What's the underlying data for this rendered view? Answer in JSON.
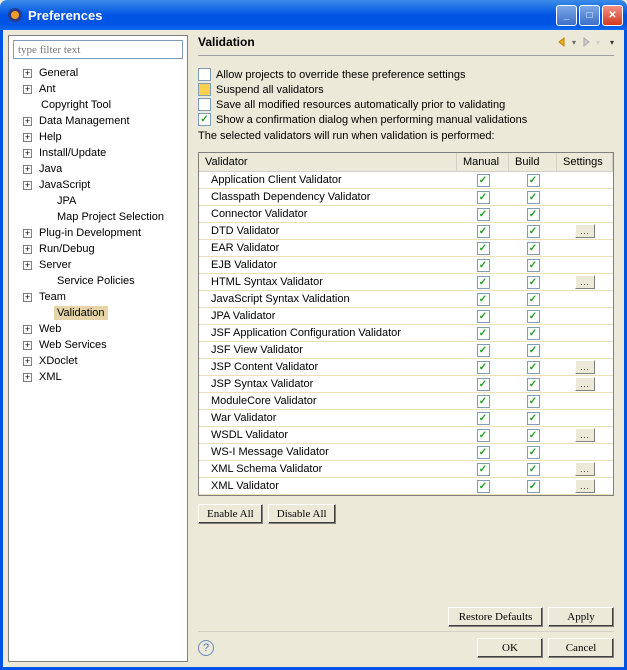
{
  "window": {
    "title": "Preferences"
  },
  "filter": {
    "placeholder": "type filter text"
  },
  "tree": [
    {
      "label": "General",
      "expand": "+",
      "indent": 1
    },
    {
      "label": "Ant",
      "expand": "+",
      "indent": 1
    },
    {
      "label": "Copyright Tool",
      "expand": "",
      "indent": 1
    },
    {
      "label": "Data Management",
      "expand": "+",
      "indent": 1
    },
    {
      "label": "Help",
      "expand": "+",
      "indent": 1
    },
    {
      "label": "Install/Update",
      "expand": "+",
      "indent": 1
    },
    {
      "label": "Java",
      "expand": "+",
      "indent": 1
    },
    {
      "label": "JavaScript",
      "expand": "+",
      "indent": 1
    },
    {
      "label": "JPA",
      "expand": "",
      "indent": 2
    },
    {
      "label": "Map Project Selection",
      "expand": "",
      "indent": 2
    },
    {
      "label": "Plug-in Development",
      "expand": "+",
      "indent": 1
    },
    {
      "label": "Run/Debug",
      "expand": "+",
      "indent": 1
    },
    {
      "label": "Server",
      "expand": "+",
      "indent": 1
    },
    {
      "label": "Service Policies",
      "expand": "",
      "indent": 2
    },
    {
      "label": "Team",
      "expand": "+",
      "indent": 1
    },
    {
      "label": "Validation",
      "expand": "",
      "indent": 2,
      "selected": true
    },
    {
      "label": "Web",
      "expand": "+",
      "indent": 1
    },
    {
      "label": "Web Services",
      "expand": "+",
      "indent": 1
    },
    {
      "label": "XDoclet",
      "expand": "+",
      "indent": 1
    },
    {
      "label": "XML",
      "expand": "+",
      "indent": 1
    }
  ],
  "header": {
    "title": "Validation"
  },
  "options": {
    "override": "Allow projects to override these preference settings",
    "suspend": "Suspend all validators",
    "saveAll": "Save all modified resources automatically prior to validating",
    "confirm": "Show a confirmation dialog when performing manual validations",
    "info": "The selected validators will run when validation is performed:"
  },
  "tableHeaders": {
    "validator": "Validator",
    "manual": "Manual",
    "build": "Build",
    "settings": "Settings"
  },
  "validators": [
    {
      "name": "Application Client Validator",
      "manual": true,
      "build": true,
      "settings": false
    },
    {
      "name": "Classpath Dependency Validator",
      "manual": true,
      "build": true,
      "settings": false
    },
    {
      "name": "Connector Validator",
      "manual": true,
      "build": true,
      "settings": false
    },
    {
      "name": "DTD Validator",
      "manual": true,
      "build": true,
      "settings": true
    },
    {
      "name": "EAR Validator",
      "manual": true,
      "build": true,
      "settings": false
    },
    {
      "name": "EJB Validator",
      "manual": true,
      "build": true,
      "settings": false
    },
    {
      "name": "HTML Syntax Validator",
      "manual": true,
      "build": true,
      "settings": true
    },
    {
      "name": "JavaScript Syntax Validation",
      "manual": true,
      "build": true,
      "settings": false
    },
    {
      "name": "JPA Validator",
      "manual": true,
      "build": true,
      "settings": false
    },
    {
      "name": "JSF Application Configuration Validator",
      "manual": true,
      "build": true,
      "settings": false
    },
    {
      "name": "JSF View Validator",
      "manual": true,
      "build": true,
      "settings": false
    },
    {
      "name": "JSP Content Validator",
      "manual": true,
      "build": true,
      "settings": true
    },
    {
      "name": "JSP Syntax Validator",
      "manual": true,
      "build": true,
      "settings": true
    },
    {
      "name": "ModuleCore Validator",
      "manual": true,
      "build": true,
      "settings": false
    },
    {
      "name": "War Validator",
      "manual": true,
      "build": true,
      "settings": false
    },
    {
      "name": "WSDL Validator",
      "manual": true,
      "build": true,
      "settings": true
    },
    {
      "name": "WS-I Message Validator",
      "manual": true,
      "build": true,
      "settings": false
    },
    {
      "name": "XML Schema Validator",
      "manual": true,
      "build": true,
      "settings": true
    },
    {
      "name": "XML Validator",
      "manual": true,
      "build": true,
      "settings": true
    }
  ],
  "buttons": {
    "enableAll": "Enable All",
    "disableAll": "Disable All",
    "restoreDefaults": "Restore Defaults",
    "apply": "Apply",
    "ok": "OK",
    "cancel": "Cancel"
  }
}
